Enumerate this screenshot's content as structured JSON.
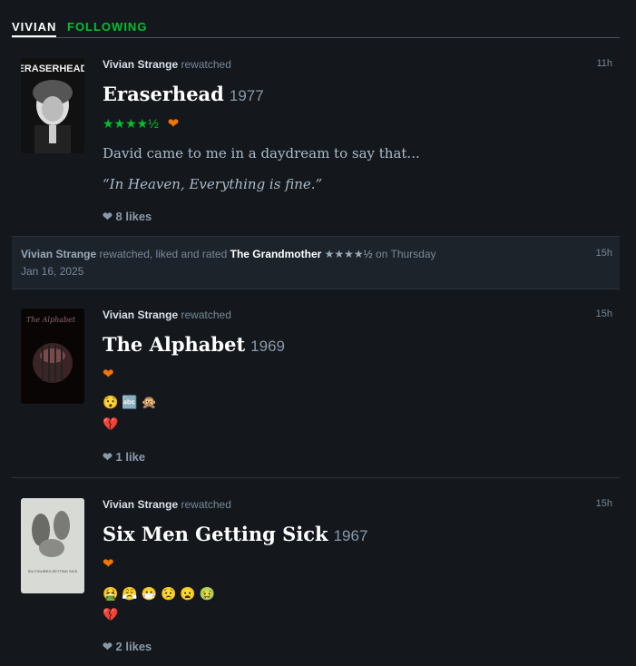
{
  "tabs": {
    "active": "VIVIAN",
    "other": "FOLLOWING"
  },
  "entries": [
    {
      "user": "Vivian Strange",
      "action": "rewatched",
      "time": "11h",
      "poster_text": "ERASERHEAD",
      "title": "Eraserhead",
      "year": "1977",
      "stars": "★★★★½",
      "heart": "❤",
      "review": [
        "David came to me in a daydream to say that...",
        "“In Heaven, Everything is fine.”"
      ],
      "likes": "8 likes"
    },
    {
      "user": "Vivian Strange",
      "action": "rewatched",
      "time": "15h",
      "poster_text": "The Alphabet",
      "title": "The Alphabet",
      "year": "1969",
      "heart": "❤",
      "emojis": "😯 🔤 🙊",
      "broken_heart": "💔",
      "likes": "1 like"
    },
    {
      "user": "Vivian Strange",
      "action": "rewatched",
      "time": "15h",
      "poster_text": "SIX FIGURES GETTING SICK",
      "title": "Six Men Getting Sick",
      "year": "1967",
      "heart": "❤",
      "emojis": "🤮 😤 😷 😟 😦 🤢",
      "broken_heart": "💔",
      "likes": "2 likes"
    }
  ],
  "activity": {
    "user": "Vivian Strange",
    "action": "rewatched, liked and rated",
    "film": "The Grandmother",
    "stars": "★★★★½",
    "when": "on Thursday",
    "date": "Jan 16, 2025",
    "time": "15h"
  },
  "colors": {
    "green": "#00c030",
    "orange": "#f27405",
    "background": "#14181c"
  }
}
